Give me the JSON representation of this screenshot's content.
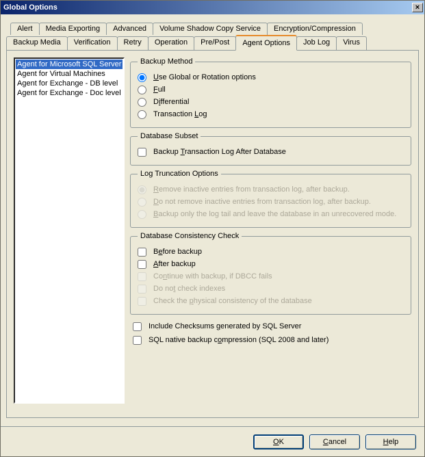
{
  "window": {
    "title": "Global Options",
    "close_icon": "×"
  },
  "tabs_row1": [
    "Alert",
    "Media Exporting",
    "Advanced",
    "Volume Shadow Copy Service",
    "Encryption/Compression"
  ],
  "tabs_row2": [
    "Backup Media",
    "Verification",
    "Retry",
    "Operation",
    "Pre/Post",
    "Agent Options",
    "Job Log",
    "Virus"
  ],
  "active_tab": "Agent Options",
  "agent_list": [
    {
      "label": "Agent for Microsoft SQL Server",
      "selected": true
    },
    {
      "label": "Agent for Virtual Machines",
      "selected": false
    },
    {
      "label": "Agent for Exchange - DB level",
      "selected": false
    },
    {
      "label": "Agent for Exchange - Doc level",
      "selected": false
    }
  ],
  "groups": {
    "backup_method": {
      "legend": "Backup Method",
      "options": [
        {
          "type": "radio",
          "label_pre": "",
          "u": "U",
          "label_post": "se Global or Rotation options",
          "checked": true,
          "enabled": true
        },
        {
          "type": "radio",
          "label_pre": "",
          "u": "F",
          "label_post": "ull",
          "checked": false,
          "enabled": true
        },
        {
          "type": "radio",
          "label_pre": "D",
          "u": "i",
          "label_post": "fferential",
          "checked": false,
          "enabled": true
        },
        {
          "type": "radio",
          "label_pre": "Transaction ",
          "u": "L",
          "label_post": "og",
          "checked": false,
          "enabled": true
        }
      ]
    },
    "db_subset": {
      "legend": "Database Subset",
      "options": [
        {
          "type": "checkbox",
          "label_pre": "Backup ",
          "u": "T",
          "label_post": "ransaction Log After Database",
          "checked": false,
          "enabled": true
        }
      ]
    },
    "log_trunc": {
      "legend": "Log Truncation Options",
      "options": [
        {
          "type": "radio",
          "label_pre": "",
          "u": "R",
          "label_post": "emove inactive entries from transaction log, after backup.",
          "checked": true,
          "enabled": false
        },
        {
          "type": "radio",
          "label_pre": "",
          "u": "D",
          "label_post": "o not remove inactive entries from transaction log, after backup.",
          "checked": false,
          "enabled": false
        },
        {
          "type": "radio",
          "label_pre": "",
          "u": "B",
          "label_post": "ackup only the log tail and leave the database in an unrecovered mode.",
          "checked": false,
          "enabled": false
        }
      ]
    },
    "dcc": {
      "legend": "Database Consistency Check",
      "options": [
        {
          "type": "checkbox",
          "label_pre": "B",
          "u": "e",
          "label_post": "fore backup",
          "checked": false,
          "enabled": true
        },
        {
          "type": "checkbox",
          "label_pre": "",
          "u": "A",
          "label_post": "fter backup",
          "checked": false,
          "enabled": true
        },
        {
          "type": "checkbox",
          "label_pre": "Co",
          "u": "n",
          "label_post": "tinue with backup, if DBCC fails",
          "checked": false,
          "enabled": false
        },
        {
          "type": "checkbox",
          "label_pre": "Do no",
          "u": "t",
          "label_post": " check indexes",
          "checked": false,
          "enabled": false
        },
        {
          "type": "checkbox",
          "label_pre": "Check the ",
          "u": "p",
          "label_post": "hysical consistency of the database",
          "checked": false,
          "enabled": false
        }
      ]
    }
  },
  "free_options": [
    {
      "type": "checkbox",
      "label_pre": "Include Checksums ",
      "u": "g",
      "label_post": "enerated by SQL Server",
      "checked": false,
      "enabled": true
    },
    {
      "type": "checkbox",
      "label_pre": "SQL native backup c",
      "u": "o",
      "label_post": "mpression (SQL 2008 and later)",
      "checked": false,
      "enabled": true
    }
  ],
  "buttons": {
    "ok": {
      "pre": "",
      "u": "O",
      "post": "K"
    },
    "cancel": {
      "pre": "",
      "u": "C",
      "post": "ancel"
    },
    "help": {
      "pre": "",
      "u": "H",
      "post": "elp"
    }
  }
}
